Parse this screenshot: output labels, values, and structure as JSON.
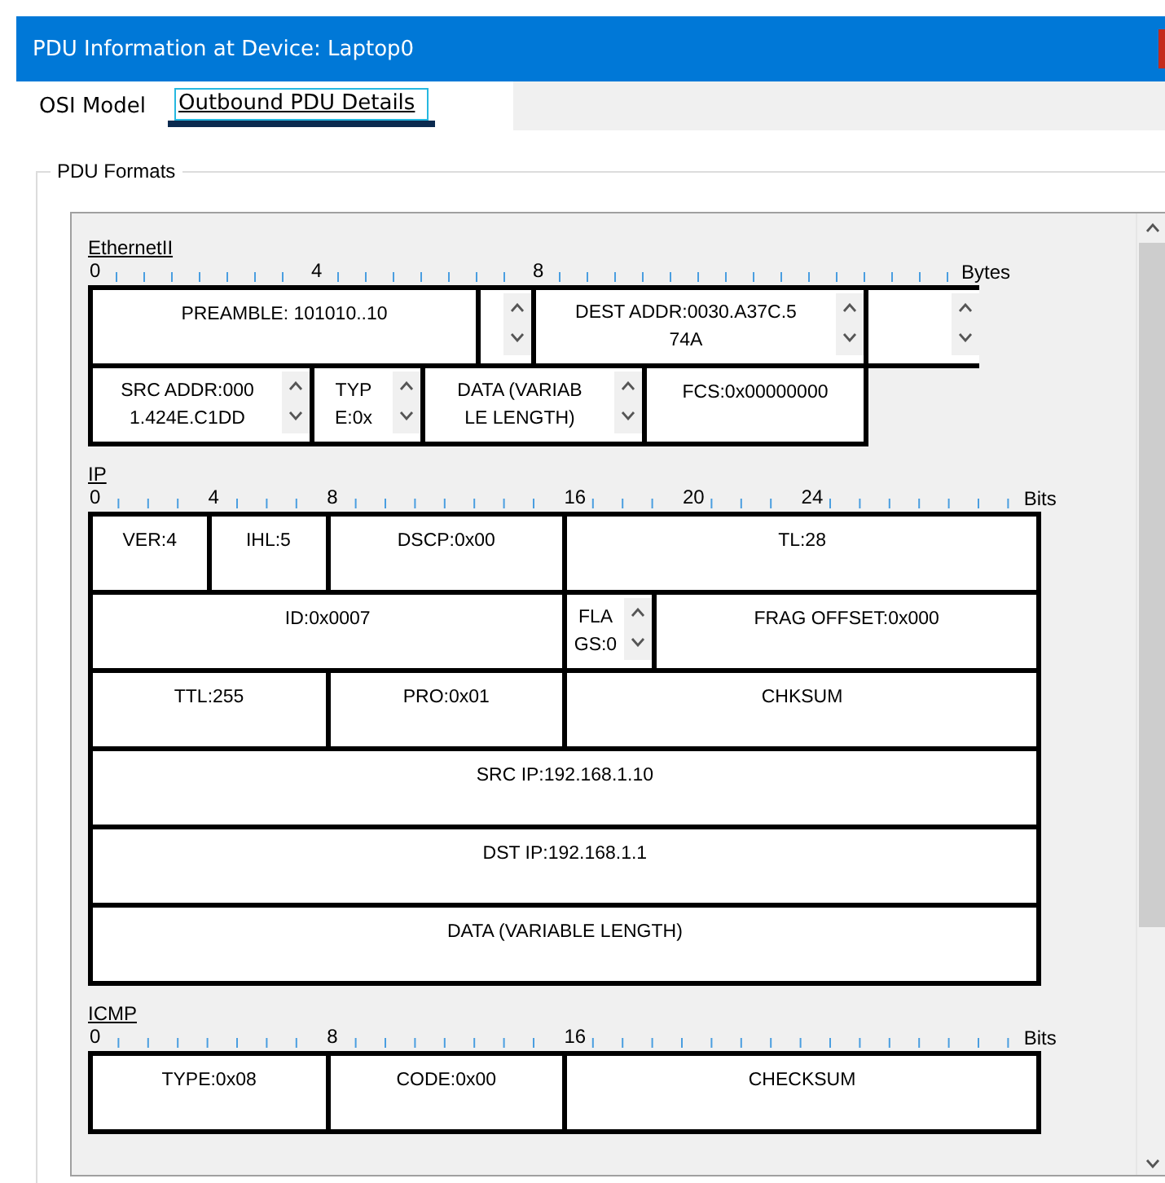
{
  "window": {
    "title": "PDU Information at Device: Laptop0"
  },
  "tabs": [
    {
      "label": "OSI Model",
      "selected": false
    },
    {
      "label": "Outbound PDU Details",
      "selected": true
    }
  ],
  "group": {
    "title": "PDU Formats"
  },
  "sections": [
    {
      "title": "EthernetII",
      "unit": "Bytes",
      "ruler": [
        "0",
        "4",
        "8"
      ],
      "lines": [
        {
          "fields": [
            {
              "text": "PREAMBLE: 101010..10",
              "kind": "plain"
            },
            {
              "kind": "spin"
            },
            {
              "text": "DEST ADDR:0030.A37C.5\n74A",
              "kind": "spin"
            },
            {
              "kind": "spin"
            }
          ]
        },
        {
          "fields": [
            {
              "text": "SRC ADDR:000\n1.424E.C1DD",
              "kind": "spin"
            },
            {
              "text": "TYP\nE:0x",
              "kind": "spin"
            },
            {
              "text": "DATA (VARIAB\nLE LENGTH)",
              "kind": "spin"
            },
            {
              "text": "FCS:0x00000000",
              "kind": "plain"
            }
          ]
        }
      ]
    },
    {
      "title": "IP",
      "unit": "Bits",
      "ruler": [
        "0",
        "4",
        "8",
        "16",
        "20",
        "24"
      ],
      "lines": [
        {
          "fields": [
            {
              "text": "VER:4",
              "kind": "plain"
            },
            {
              "text": "IHL:5",
              "kind": "plain"
            },
            {
              "text": "DSCP:0x00",
              "kind": "plain"
            },
            {
              "text": "TL:28",
              "kind": "plain"
            }
          ]
        },
        {
          "fields": [
            {
              "text": "ID:0x0007",
              "kind": "plain"
            },
            {
              "text": "FLA\nGS:0",
              "kind": "spin"
            },
            {
              "text": "FRAG OFFSET:0x000",
              "kind": "plain"
            }
          ]
        },
        {
          "fields": [
            {
              "text": "TTL:255",
              "kind": "plain"
            },
            {
              "text": "PRO:0x01",
              "kind": "plain"
            },
            {
              "text": "CHKSUM",
              "kind": "plain"
            }
          ]
        },
        {
          "fields": [
            {
              "text": "SRC IP:192.168.1.10",
              "kind": "plain"
            }
          ]
        },
        {
          "fields": [
            {
              "text": "DST IP:192.168.1.1",
              "kind": "plain"
            }
          ]
        },
        {
          "fields": [
            {
              "text": "DATA (VARIABLE LENGTH)",
              "kind": "plain"
            }
          ]
        }
      ]
    },
    {
      "title": "ICMP",
      "unit": "Bits",
      "ruler": [
        "0",
        "8",
        "16"
      ],
      "lines": [
        {
          "fields": [
            {
              "text": "TYPE:0x08",
              "kind": "plain"
            },
            {
              "text": "CODE:0x00",
              "kind": "plain"
            },
            {
              "text": "CHECKSUM",
              "kind": "plain"
            }
          ]
        }
      ]
    }
  ]
}
